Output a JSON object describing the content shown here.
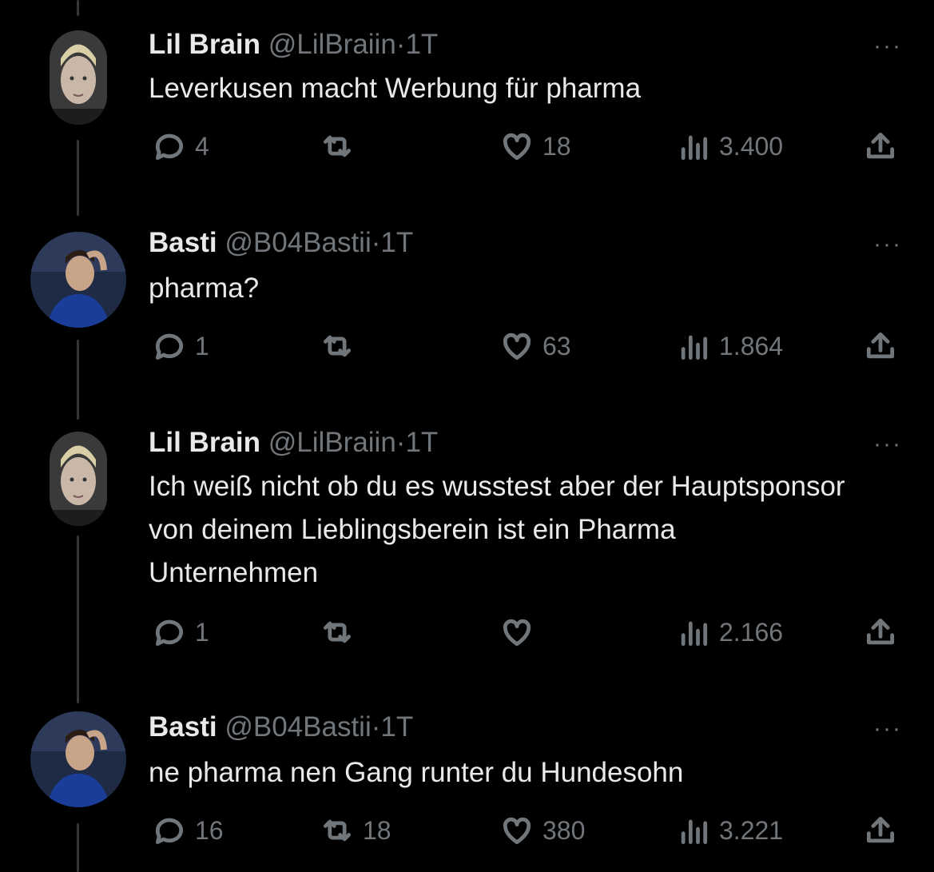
{
  "tweets": [
    {
      "name": "Lil Brain",
      "handle": "@LilBraiin",
      "time": "1T",
      "text": "Leverkusen macht Werbung für pharma",
      "replies": "4",
      "retweets": "",
      "likes": "18",
      "views": "3.400"
    },
    {
      "name": "Basti",
      "handle": "@B04Bastii",
      "time": "1T",
      "text": "pharma?",
      "replies": "1",
      "retweets": "",
      "likes": "63",
      "views": "1.864"
    },
    {
      "name": "Lil Brain",
      "handle": "@LilBraiin",
      "time": "1T",
      "text": "Ich weiß nicht ob du es wusstest aber der Hauptsponsor von deinem Lieblingsberein ist ein Pharma Unternehmen",
      "replies": "1",
      "retweets": "",
      "likes": "",
      "views": "2.166"
    },
    {
      "name": "Basti",
      "handle": "@B04Bastii",
      "time": "1T",
      "text": "ne pharma nen Gang runter du Hundesohn",
      "replies": "16",
      "retweets": "18",
      "likes": "380",
      "views": "3.221"
    }
  ],
  "ui": {
    "separator": "·",
    "more": "···"
  },
  "colors": {
    "background": "#000000",
    "text": "#e7e9ea",
    "secondary": "#71767b",
    "thread_line": "#333639"
  },
  "icons": [
    "reply-icon",
    "retweet-icon",
    "like-icon",
    "views-icon",
    "share-icon",
    "more-icon"
  ]
}
